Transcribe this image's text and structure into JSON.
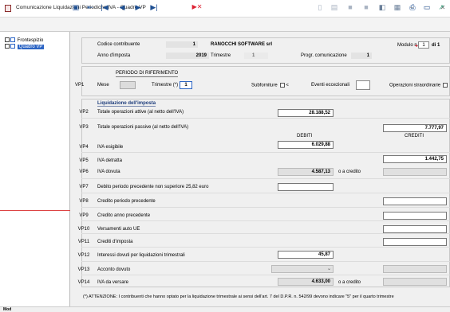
{
  "window": {
    "title": "Comunicazione Liquidazioni Periodiche IVA - Quadro VP",
    "min": "–",
    "max": "□",
    "close": "✕"
  },
  "toolbar": {
    "icons": [
      "save-icon",
      "exit-icon",
      "first-icon",
      "prev-icon",
      "next-icon",
      "last-icon",
      "delete-icon",
      "print-preview-icon",
      "doc-icon",
      "panel-icon",
      "panel2-icon",
      "help-icon",
      "grid-icon",
      "print-icon",
      "monitor-icon",
      "export-icon"
    ]
  },
  "tree": {
    "items": [
      {
        "label": "Frontespizio"
      },
      {
        "label": "Quadro VP"
      }
    ]
  },
  "header": {
    "codice_label": "Codice contribuente",
    "codice_value": "1",
    "company": "RANOCCHI SOFTWARE srl",
    "modulo_label": "Modulo n.",
    "modulo_value": "1",
    "modulo_of": "di 1",
    "anno_label": "Anno d'imposta",
    "anno_value": "2019",
    "trimestre_label": "Trimestre",
    "trimestre_value": "1",
    "progr_label": "Progr. comunicazione",
    "progr_value": "1"
  },
  "periodo": {
    "code": "VP1",
    "title": "PERIODO DI RIFERIMENTO",
    "mese_label": "Mese",
    "mese_value": "",
    "trimestre_label": "Trimestre (*)",
    "trimestre_value": "1",
    "subforniture_label": "Subforniture",
    "subforniture_sym": "<",
    "eventi_label": "Eventi eccezionali",
    "eventi_value": "",
    "operazioni_label": "Operazioni straordinarie"
  },
  "liquidazione": {
    "title": "Liquidazione dell'imposta",
    "debiti_label": "DEBITI",
    "crediti_label": "CREDITI",
    "rows": [
      {
        "code": "VP2",
        "label": "Totale operazioni attive (al netto dell'IVA)",
        "debiti": "28.188,52",
        "crediti": ""
      },
      {
        "code": "VP3",
        "label": "Totale operazioni passive (al netto dell'IVA)",
        "debiti": "",
        "crediti": "7.777,97"
      },
      {
        "code": "VP4",
        "label": "IVA esigibile",
        "debiti": "6.029,88",
        "crediti": ""
      },
      {
        "code": "VP5",
        "label": "IVA detratta",
        "debiti": "",
        "crediti": "1.442,75"
      },
      {
        "code": "VP6",
        "label": "IVA dovuta",
        "debiti": "4.587,13",
        "crediti": "",
        "suffix": "o a credito"
      },
      {
        "code": "VP7",
        "label": "Debito periodo precedente non superiore 25,82 euro",
        "debiti": "",
        "crediti": ""
      },
      {
        "code": "VP8",
        "label": "Credito periodo precedente",
        "debiti": "",
        "crediti": ""
      },
      {
        "code": "VP9",
        "label": "Credito anno precedente",
        "debiti": "",
        "crediti": ""
      },
      {
        "code": "VP10",
        "label": "Versamenti auto UE",
        "debiti": "",
        "crediti": ""
      },
      {
        "code": "VP11",
        "label": "Crediti d'imposta",
        "debiti": "",
        "crediti": ""
      },
      {
        "code": "VP12",
        "label": "Interessi dovuti per liquidazioni trimestrali",
        "debiti": "45,87",
        "crediti": ""
      },
      {
        "code": "VP13",
        "label": "Acconto dovuto",
        "debiti": "",
        "crediti": ""
      },
      {
        "code": "VP14",
        "label": "IVA da versare",
        "debiti": "4.633,00",
        "crediti": "",
        "suffix": "o a credito"
      }
    ]
  },
  "footnote": "(*) ATTENZIONE: I contribuenti che hanno optato per la liquidazione trimestrale ai sensi dell'art. 7 del D.P.R. n. 542/99 devono indicare \"5\" per il quarto trimestre",
  "status": {
    "mode": "Mod"
  }
}
